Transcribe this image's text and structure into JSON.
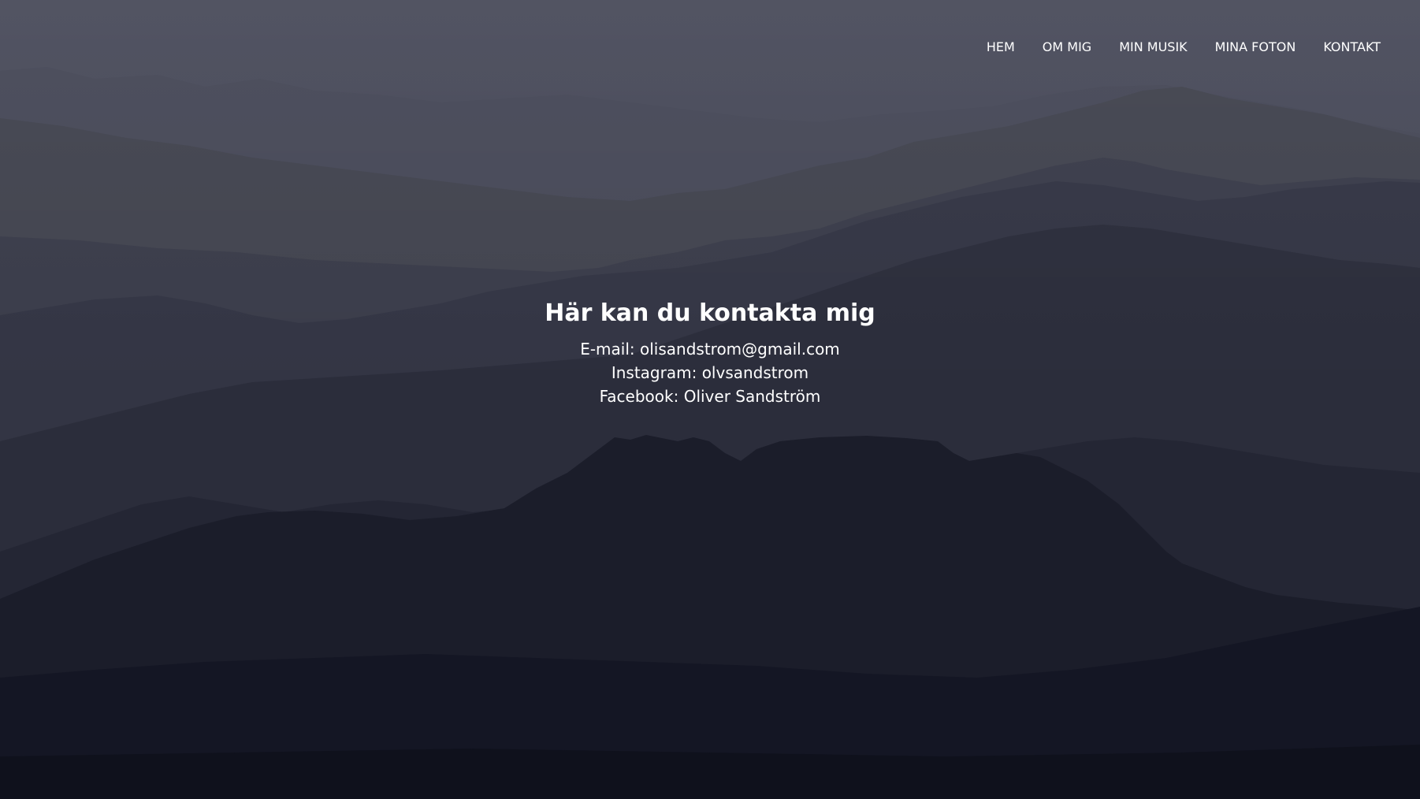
{
  "theme": {
    "sky_top": "#4b4d5c",
    "ground_bottom": "#0f111c",
    "text": "#ffffff"
  },
  "nav": {
    "items": [
      {
        "label": "HEM"
      },
      {
        "label": "OM MIG"
      },
      {
        "label": "MIN MUSIK"
      },
      {
        "label": "MINA FOTON"
      },
      {
        "label": "KONTAKT"
      }
    ]
  },
  "contact": {
    "title": "Här kan du kontakta mig",
    "email": "E-mail: olisandstrom@gmail.com",
    "instagram": "Instagram: olvsandstrom",
    "facebook": "Facebook: Oliver Sandström"
  }
}
